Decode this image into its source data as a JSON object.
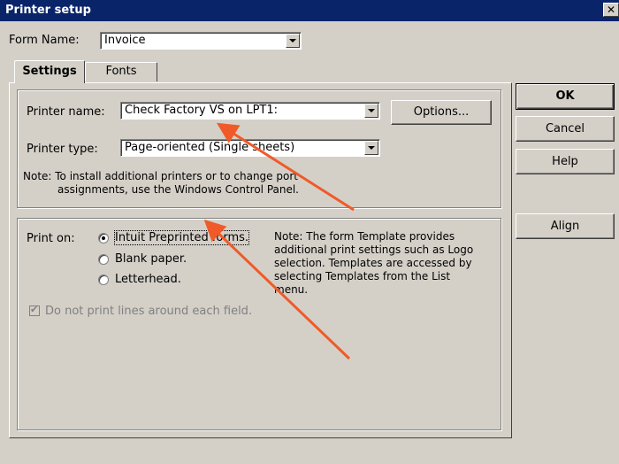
{
  "window": {
    "title": "Printer setup",
    "close_glyph": "✕"
  },
  "form_name": {
    "label": "Form Name:",
    "value": "Invoice"
  },
  "tabs": [
    {
      "label": "Settings",
      "selected": true
    },
    {
      "label": "Fonts",
      "selected": false
    }
  ],
  "printer": {
    "name_label": "Printer name:",
    "name_value": "Check Factory VS on LPT1:",
    "type_label": "Printer type:",
    "type_value": "Page-oriented (Single sheets)",
    "options_label": "Options...",
    "note_line1": "Note: To install additional printers or to change port",
    "note_line2": "assignments, use the Windows Control Panel."
  },
  "print_on": {
    "label": "Print on:",
    "options": [
      {
        "label": "Intuit Preprinted forms.",
        "selected": true
      },
      {
        "label": "Blank paper.",
        "selected": false
      },
      {
        "label": "Letterhead.",
        "selected": false
      }
    ],
    "checkbox_label": "Do not print lines around each field.",
    "checkbox_checked": true,
    "checkbox_enabled": false,
    "note": [
      "Note: The form Template provides",
      "additional print settings such as Logo",
      "selection.  Templates are accessed by",
      "selecting Templates from the List",
      "menu."
    ]
  },
  "buttons": {
    "ok": "OK",
    "cancel": "Cancel",
    "help": "Help",
    "align": "Align"
  },
  "annotation_color": "#f05a28"
}
